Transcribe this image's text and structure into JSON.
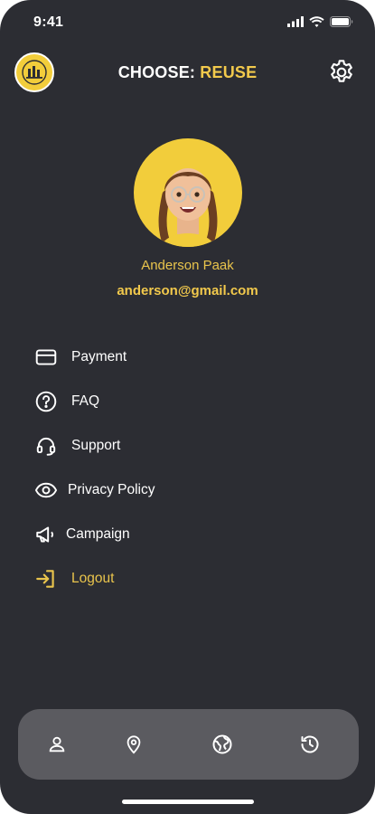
{
  "status_bar": {
    "time": "9:41"
  },
  "header": {
    "title_prefix": "CHOOSE: ",
    "title_accent": "REUSE",
    "logo_icon": "recycle-logo-icon",
    "settings_icon": "gear-icon"
  },
  "profile": {
    "name": "Anderson Paak",
    "email": "anderson@gmail.com",
    "avatar_icon": "memoji-avatar"
  },
  "menu": {
    "items": [
      {
        "label": "Payment",
        "icon": "credit-card-icon"
      },
      {
        "label": "FAQ",
        "icon": "question-circle-icon"
      },
      {
        "label": "Support",
        "icon": "headset-icon"
      },
      {
        "label": "Privacy Policy",
        "icon": "eye-icon"
      },
      {
        "label": "Campaign",
        "icon": "megaphone-icon"
      },
      {
        "label": "Logout",
        "icon": "logout-icon"
      }
    ]
  },
  "bottom_nav": {
    "items": [
      {
        "icon": "user-icon"
      },
      {
        "icon": "location-pin-icon"
      },
      {
        "icon": "globe-icon"
      },
      {
        "icon": "history-icon"
      }
    ]
  },
  "colors": {
    "background": "#2c2d33",
    "accent": "#f2c94c",
    "nav_bg": "#5b5b60"
  }
}
